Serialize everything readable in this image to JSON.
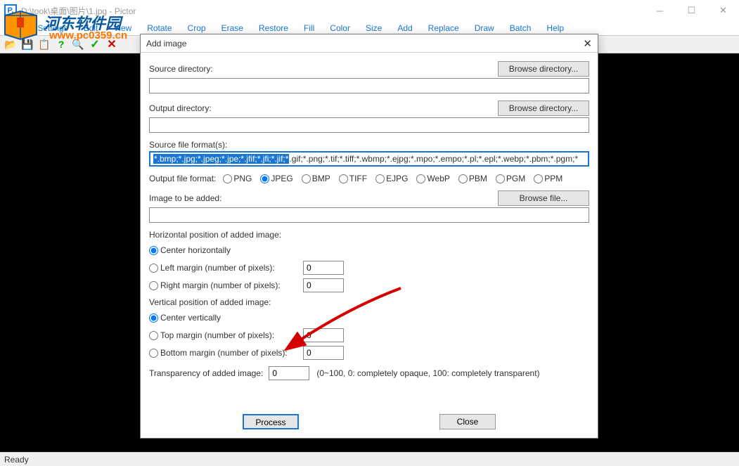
{
  "titlebar": "D:\\took\\桌面\\图片\\1.jpg - Pictor",
  "menu": [
    "File",
    "Settings",
    "Edit",
    "View",
    "Rotate",
    "Crop",
    "Erase",
    "Restore",
    "Fill",
    "Color",
    "Size",
    "Add",
    "Replace",
    "Draw",
    "Batch",
    "Help"
  ],
  "status": "Ready",
  "watermark": {
    "name": "河东软件园",
    "url": "www.pc0359.cn"
  },
  "dialog": {
    "title": "Add image",
    "source_dir_label": "Source directory:",
    "source_dir_value": "",
    "output_dir_label": "Output directory:",
    "output_dir_value": "",
    "browse_dir": "Browse directory...",
    "browse_file": "Browse file...",
    "formats_label": "Source file format(s):",
    "formats_selected": "*.bmp;*.jpg;*.jpeg;*.jpe;*.jfif;*.jfi;*.jif;*",
    "formats_rest": ".gif;*.png;*.tif;*.tiff;*.wbmp;*.ejpg;*.mpo;*.empo;*.pl;*.epl;*.webp;*.pbm;*.pgm;*",
    "out_fmt_label": "Output file format:",
    "out_formats": [
      "PNG",
      "JPEG",
      "BMP",
      "TIFF",
      "EJPG",
      "WebP",
      "PBM",
      "PGM",
      "PPM"
    ],
    "out_selected": "JPEG",
    "image_add_label": "Image to be added:",
    "image_add_value": "",
    "hpos_title": "Horizontal position of added image:",
    "hpos": {
      "center": "Center horizontally",
      "left": "Left margin (number of pixels):",
      "right": "Right margin (number of pixels):",
      "left_val": "0",
      "right_val": "0",
      "selected": "center"
    },
    "vpos_title": "Vertical position of added image:",
    "vpos": {
      "center": "Center vertically",
      "top": "Top margin (number of pixels):",
      "bottom": "Bottom margin (number of pixels):",
      "top_val": "0",
      "bottom_val": "0",
      "selected": "center"
    },
    "trans_label": "Transparency of added image:",
    "trans_val": "0",
    "trans_hint": "(0~100, 0: completely opaque, 100: completely transparent)",
    "process": "Process",
    "close": "Close"
  }
}
